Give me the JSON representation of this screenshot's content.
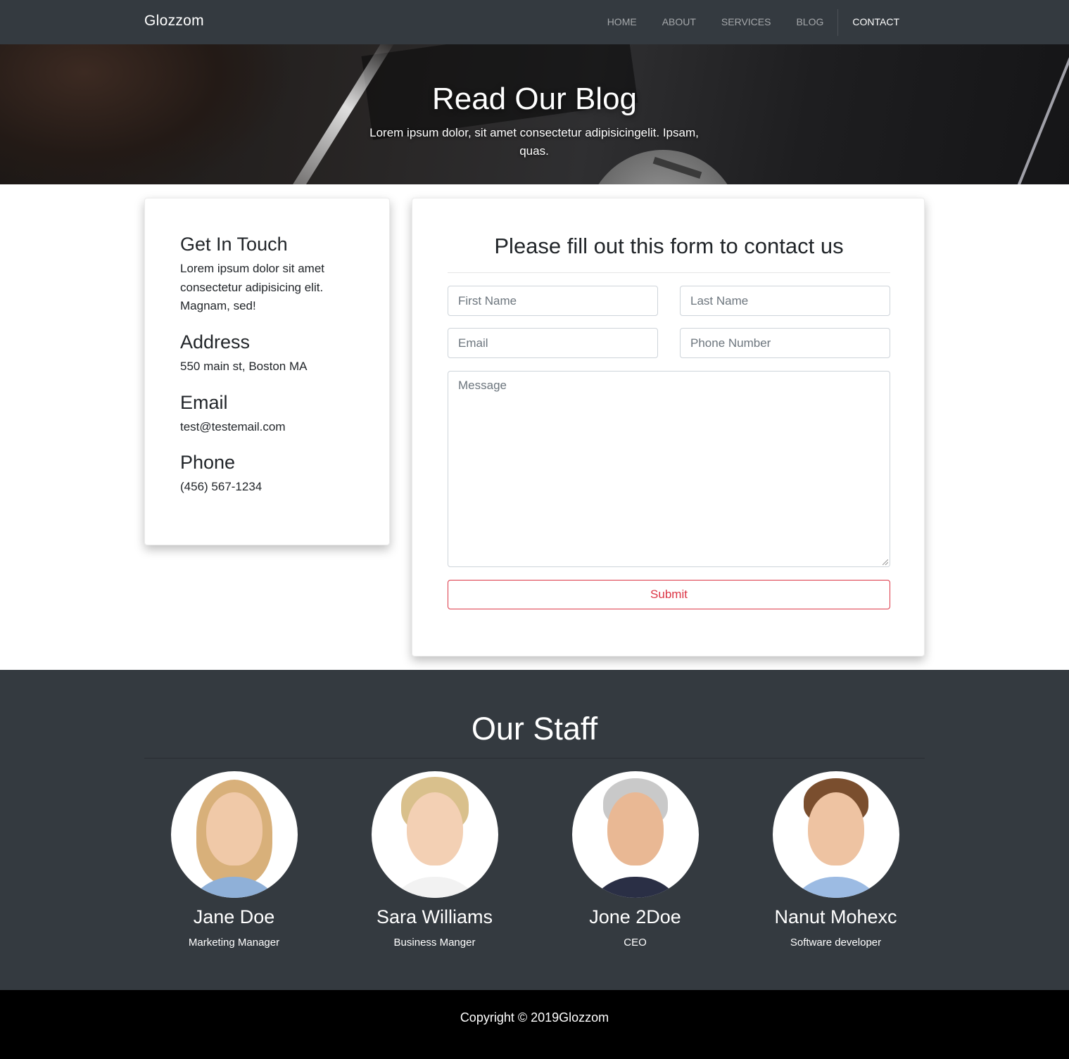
{
  "navbar": {
    "brand": "Glozzom",
    "links": [
      "HOME",
      "ABOUT",
      "SERVICES",
      "BLOG",
      "CONTACT"
    ],
    "active": "CONTACT"
  },
  "hero": {
    "title": "Read Our Blog",
    "subtitle": "Lorem ipsum dolor, sit amet consectetur adipisicingelit. Ipsam, quas."
  },
  "info": {
    "heading": "Get In Touch",
    "text": "Lorem ipsum dolor sit amet consectetur adipisicing elit. Magnam, sed!",
    "address_label": "Address",
    "address": "550 main st, Boston MA",
    "email_label": "Email",
    "email": "test@testemail.com",
    "phone_label": "Phone",
    "phone": "(456) 567-1234"
  },
  "form": {
    "title": "Please fill out this form to contact us",
    "first_name_placeholder": "First Name",
    "last_name_placeholder": "Last Name",
    "email_placeholder": "Email",
    "phone_placeholder": "Phone Number",
    "message_placeholder": "Message",
    "submit_label": "Submit"
  },
  "staff": {
    "title": "Our Staff",
    "members": [
      {
        "name": "Jane Doe",
        "role": "Marketing Manager"
      },
      {
        "name": "Sara Williams",
        "role": "Business Manger"
      },
      {
        "name": "Jone 2Doe",
        "role": "CEO"
      },
      {
        "name": "Nanut Mohexc",
        "role": "Software developer"
      }
    ]
  },
  "footer": {
    "copyright": "Copyright © 2019Glozzom"
  },
  "colors": {
    "navbar_bg": "#343a40",
    "staff_bg": "#343a40",
    "footer_bg": "#000000",
    "submit_accent": "#dc3545"
  }
}
